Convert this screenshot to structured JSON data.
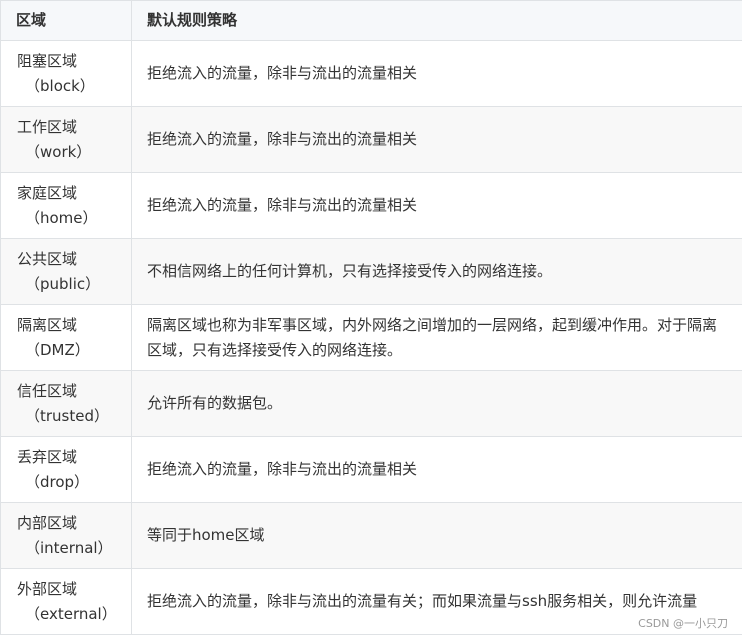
{
  "header": {
    "zone": "区域",
    "policy": "默认规则策略"
  },
  "rows": [
    {
      "zone_cn": "阻塞区域",
      "zone_en": "（block）",
      "policy": "拒绝流入的流量，除非与流出的流量相关"
    },
    {
      "zone_cn": "工作区域",
      "zone_en": "（work）",
      "policy": "拒绝流入的流量，除非与流出的流量相关"
    },
    {
      "zone_cn": "家庭区域",
      "zone_en": "（home）",
      "policy": "拒绝流入的流量，除非与流出的流量相关"
    },
    {
      "zone_cn": "公共区域",
      "zone_en": "（public）",
      "policy": "不相信网络上的任何计算机，只有选择接受传入的网络连接。"
    },
    {
      "zone_cn": "隔离区域",
      "zone_en": "（DMZ）",
      "policy": "隔离区域也称为非军事区域，内外网络之间增加的一层网络，起到缓冲作用。对于隔离区域，只有选择接受传入的网络连接。"
    },
    {
      "zone_cn": "信任区域",
      "zone_en": "（trusted）",
      "policy": "允许所有的数据包。"
    },
    {
      "zone_cn": "丢弃区域",
      "zone_en": "（drop）",
      "policy": "拒绝流入的流量，除非与流出的流量相关"
    },
    {
      "zone_cn": "内部区域",
      "zone_en": "（internal）",
      "policy": "等同于home区域"
    },
    {
      "zone_cn": "外部区域",
      "zone_en": "（external）",
      "policy": "拒绝流入的流量，除非与流出的流量有关；而如果流量与ssh服务相关，则允许流量"
    }
  ],
  "watermark": "CSDN @一小只刀"
}
